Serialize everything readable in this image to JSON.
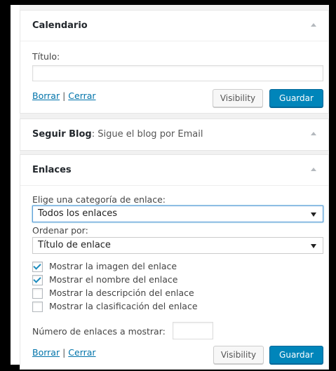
{
  "calendar_widget": {
    "title": "Calendario",
    "title_field_label": "Título:",
    "title_field_value": "",
    "delete_link": "Borrar",
    "separator": "|",
    "close_link": "Cerrar",
    "visibility_button": "Visibility",
    "save_button": "Guardar"
  },
  "follow_widget": {
    "title": "Seguir Blog",
    "subtitle": ": Sigue el blog por Email"
  },
  "links_widget": {
    "title": "Enlaces",
    "category_label": "Elige una categoría de enlace:",
    "category_value": "Todos los enlaces",
    "order_label": "Ordenar por:",
    "order_value": "Título de enlace",
    "options": [
      {
        "label": "Mostrar la imagen del enlace",
        "checked": true
      },
      {
        "label": "Mostrar el nombre del enlace",
        "checked": true
      },
      {
        "label": "Mostrar la descripción del enlace",
        "checked": false
      },
      {
        "label": "Mostrar la clasificación del enlace",
        "checked": false
      }
    ],
    "count_label": "Número de enlaces a mostrar:",
    "count_value": "",
    "delete_link": "Borrar",
    "separator": "|",
    "close_link": "Cerrar",
    "visibility_button": "Visibility",
    "save_button": "Guardar"
  },
  "colors": {
    "primary_button": "#0085ba",
    "link": "#0073aa",
    "background": "#f1f1f1"
  }
}
